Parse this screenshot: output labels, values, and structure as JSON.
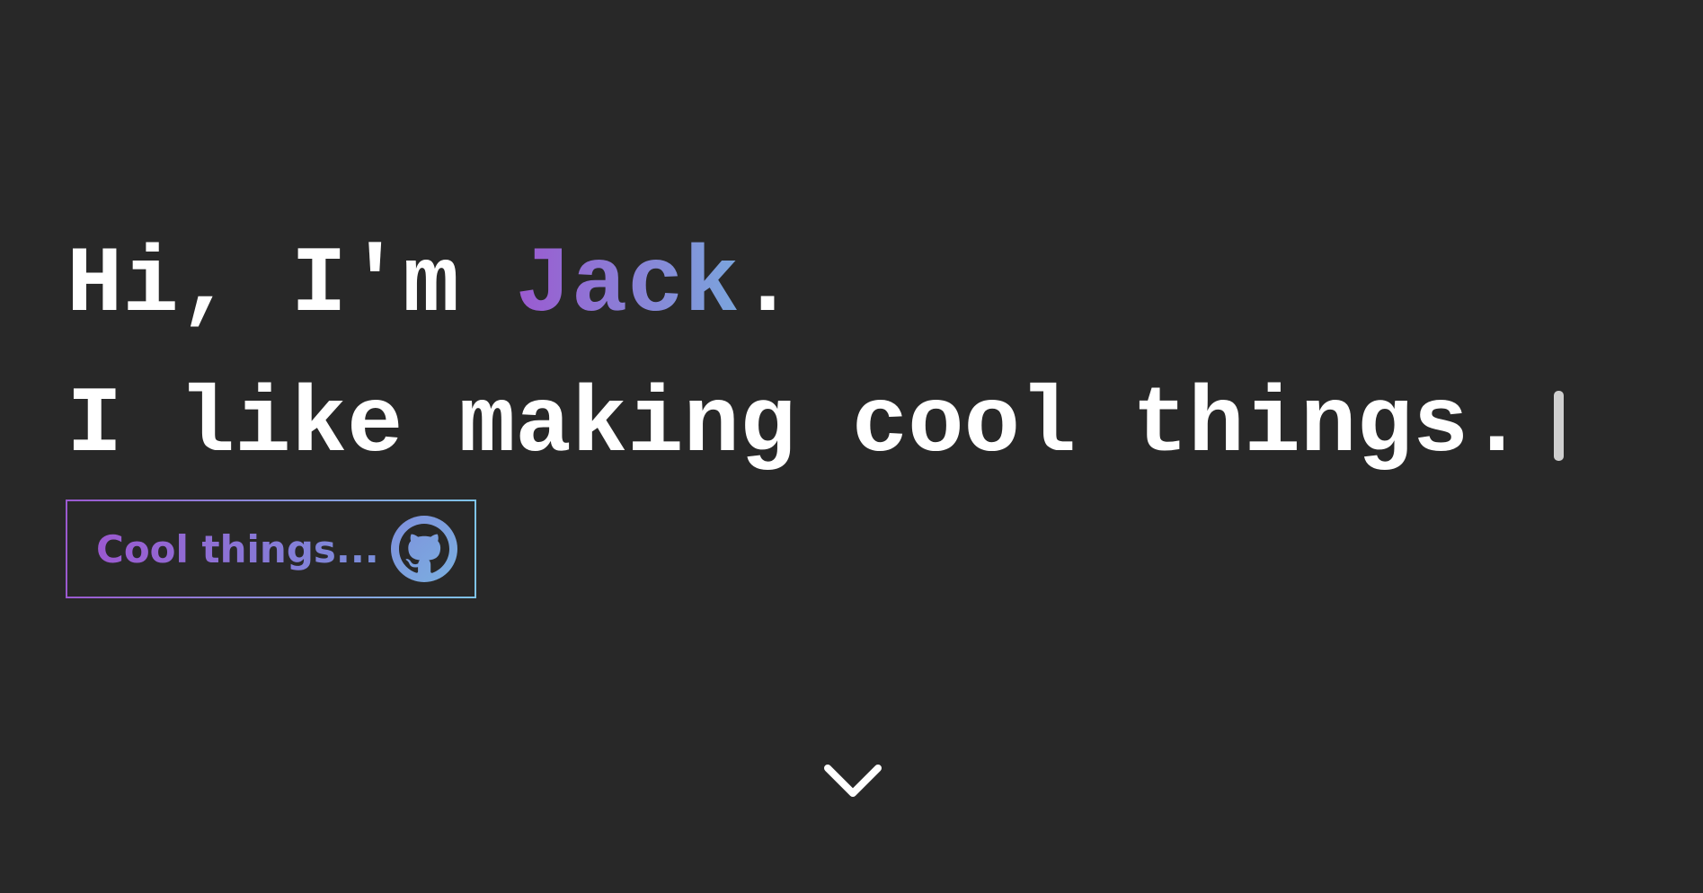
{
  "hero": {
    "greeting_prefix": "Hi, I'm ",
    "name": "Jack",
    "greeting_suffix": ".",
    "tagline": "I like making cool things."
  },
  "cta": {
    "label": "Cool things...",
    "icon": "github-icon"
  },
  "scroll": {
    "icon": "chevron-down-icon"
  },
  "colors": {
    "background": "#282828",
    "text": "#ffffff",
    "gradient_start": "#9b59d0",
    "gradient_end": "#7ec3e6"
  }
}
